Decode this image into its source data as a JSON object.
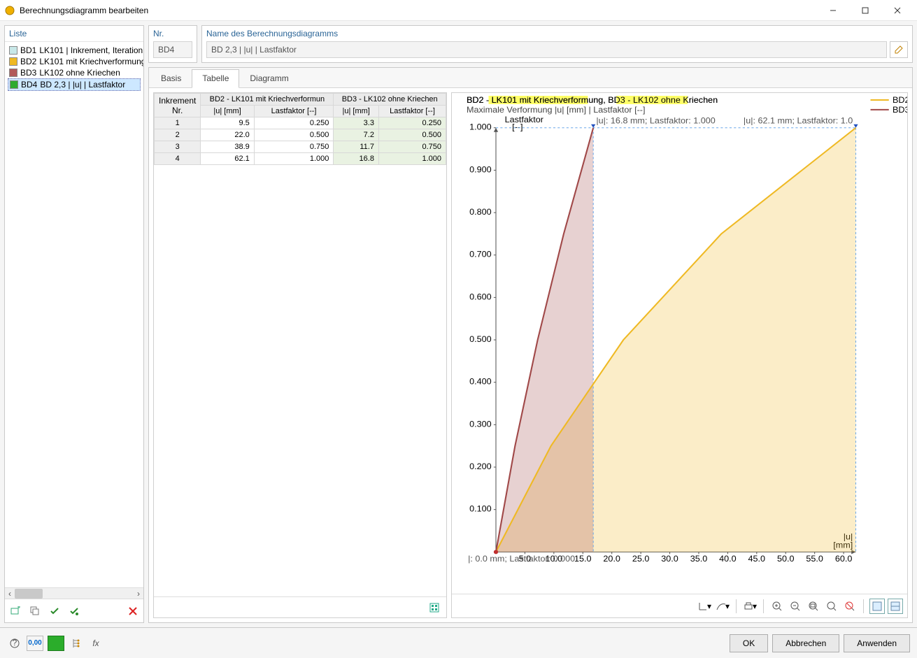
{
  "window": {
    "title": "Berechnungsdiagramm bearbeiten"
  },
  "left": {
    "header": "Liste",
    "items": [
      {
        "id": "BD1",
        "label": "LK101 | Inkrement, Iteration |",
        "color": "#c8e8e8"
      },
      {
        "id": "BD2",
        "label": "LK101 mit Kriechverformung",
        "color": "#efb923"
      },
      {
        "id": "BD3",
        "label": "LK102 ohne Kriechen",
        "color": "#b25a5a"
      },
      {
        "id": "BD4",
        "label": "BD 2,3 | |u| | Lastfaktor",
        "color": "#2eaa2e",
        "selected": true
      }
    ]
  },
  "editor": {
    "nr_label": "Nr.",
    "nr_value": "BD4",
    "name_label": "Name des Berechnungsdiagramms",
    "name_value": "BD 2,3 | |u| | Lastfaktor",
    "tabs": {
      "basis": "Basis",
      "tabelle": "Tabelle",
      "diagramm": "Diagramm"
    }
  },
  "table": {
    "inc_header": "Inkrement\nNr.",
    "inc_top": "Inkrement",
    "inc_bot": "Nr.",
    "group1": "BD2 - LK101 mit Kriechverformun",
    "group2": "BD3 - LK102 ohne Kriechen",
    "col_u": "|u| [mm]",
    "col_lf": "Lastfaktor [--]",
    "rows": [
      {
        "i": "1",
        "u1": "9.5",
        "lf1": "0.250",
        "u2": "3.3",
        "lf2": "0.250"
      },
      {
        "i": "2",
        "u1": "22.0",
        "lf1": "0.500",
        "u2": "7.2",
        "lf2": "0.500"
      },
      {
        "i": "3",
        "u1": "38.9",
        "lf1": "0.750",
        "u2": "11.7",
        "lf2": "0.750"
      },
      {
        "i": "4",
        "u1": "62.1",
        "lf1": "1.000",
        "u2": "16.8",
        "lf2": "1.000"
      }
    ]
  },
  "chart_data": {
    "type": "line",
    "title_prefix": "BD2 - ",
    "title_h1": "LK101 mit Kriechverformung",
    "title_mid": ", BD3 - ",
    "title_h2": "LK102 ohne Kriechen",
    "subtitle": "Maximale Verformung |u| [mm] | Lastfaktor [--]",
    "xlabel": "|u|\n[mm]",
    "ylabel": "Lastfaktor\n[--]",
    "xlim": [
      0,
      62.1
    ],
    "ylim": [
      0,
      1.0
    ],
    "xticks": [
      5,
      10,
      15,
      20,
      25,
      30,
      35,
      40,
      45,
      50,
      55,
      60
    ],
    "yticks": [
      0.1,
      0.2,
      0.3,
      0.4,
      0.5,
      0.6,
      0.7,
      0.8,
      0.9,
      1.0
    ],
    "series": [
      {
        "name": "BD2",
        "color": "#efb923",
        "x": [
          0,
          9.5,
          22.0,
          38.9,
          62.1
        ],
        "y": [
          0,
          0.25,
          0.5,
          0.75,
          1.0
        ]
      },
      {
        "name": "BD3",
        "color": "#a04848",
        "x": [
          0,
          3.3,
          7.2,
          11.7,
          16.8
        ],
        "y": [
          0,
          0.25,
          0.5,
          0.75,
          1.0
        ]
      }
    ],
    "legend": [
      "BD2",
      "BD3"
    ],
    "annotations": [
      {
        "text": "|: 0.0 mm; Lastfaktor: 0.000",
        "x": 0,
        "y": 0
      },
      {
        "text": "|u|: 16.8 mm; Lastfaktor: 1.000",
        "x": 16.8,
        "y": 1.0
      },
      {
        "text": "|u|: 62.1 mm; Lastfaktor: 1.0",
        "x": 62.1,
        "y": 1.0
      }
    ]
  },
  "footer": {
    "ok": "OK",
    "cancel": "Abbrechen",
    "apply": "Anwenden"
  }
}
